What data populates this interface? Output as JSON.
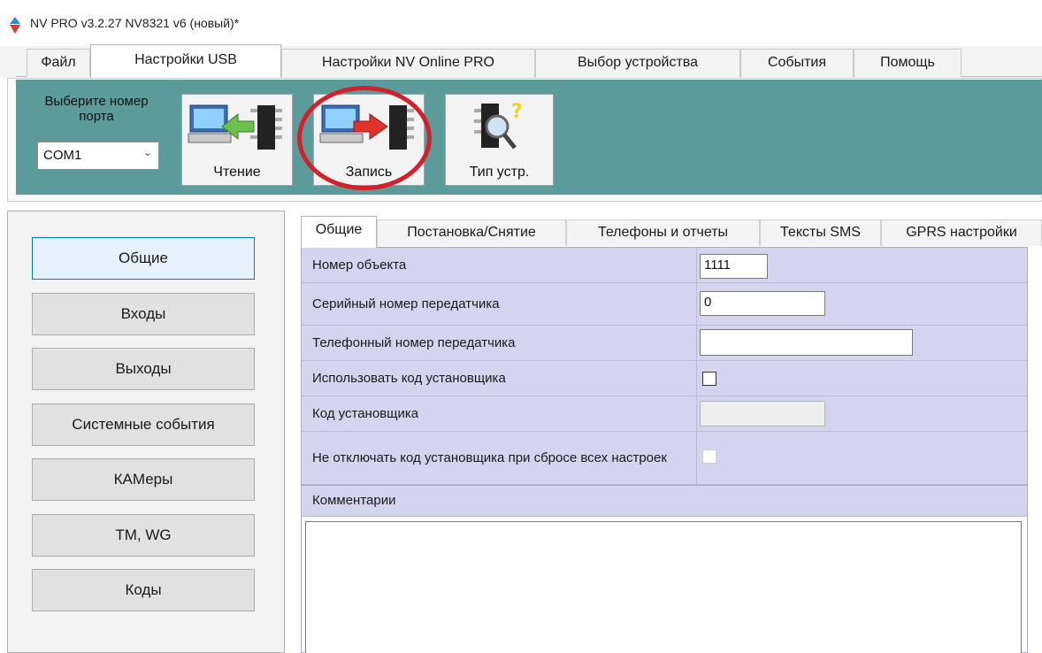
{
  "window": {
    "title": "NV PRO v3.2.27 NV8321 v6 (новый)*"
  },
  "menu": {
    "tabs": [
      {
        "label": "Файл"
      },
      {
        "label": "Настройки USB"
      },
      {
        "label": "Настройки NV Online PRO"
      },
      {
        "label": "Выбор устройства"
      },
      {
        "label": "События"
      },
      {
        "label": "Помощь"
      }
    ],
    "active": "Настройки USB"
  },
  "toolbar": {
    "port_label": "Выберите номер порта",
    "port_value": "COM1",
    "read_label": "Чтение",
    "write_label": "Запись",
    "device_type_label": "Тип устр."
  },
  "nav": {
    "items": [
      {
        "label": "Общие"
      },
      {
        "label": "Входы"
      },
      {
        "label": "Выходы"
      },
      {
        "label": "Системные события"
      },
      {
        "label": "КАМеры"
      },
      {
        "label": "TM, WG"
      },
      {
        "label": "Коды"
      }
    ],
    "active": "Общие"
  },
  "content_tabs": {
    "items": [
      {
        "label": "Общие"
      },
      {
        "label": "Постановка/Снятие"
      },
      {
        "label": "Телефоны и отчеты"
      },
      {
        "label": "Тексты SMS"
      },
      {
        "label": "GPRS настройки"
      }
    ],
    "active": "Общие"
  },
  "general": {
    "object_number": {
      "label": "Номер объекта",
      "value": "1111"
    },
    "transmitter_serial": {
      "label": "Серийный номер передатчика",
      "value": "0"
    },
    "transmitter_phone": {
      "label": "Телефонный номер передатчика",
      "value": ""
    },
    "use_installer_code": {
      "label": "Использовать код установщика",
      "checked": false
    },
    "installer_code": {
      "label": "Код установщика",
      "value": ""
    },
    "keep_installer_code": {
      "label": "Не отключать код установщика при сбросе всех настроек",
      "checked": false
    },
    "comments": {
      "label": "Комментарии",
      "value": ""
    }
  },
  "colors": {
    "toolbar_bg": "#5b9b9a",
    "grid_row_bg": "#d4d4ee",
    "highlight_circle": "#d4202a",
    "active_nav_border": "#0078d7"
  }
}
